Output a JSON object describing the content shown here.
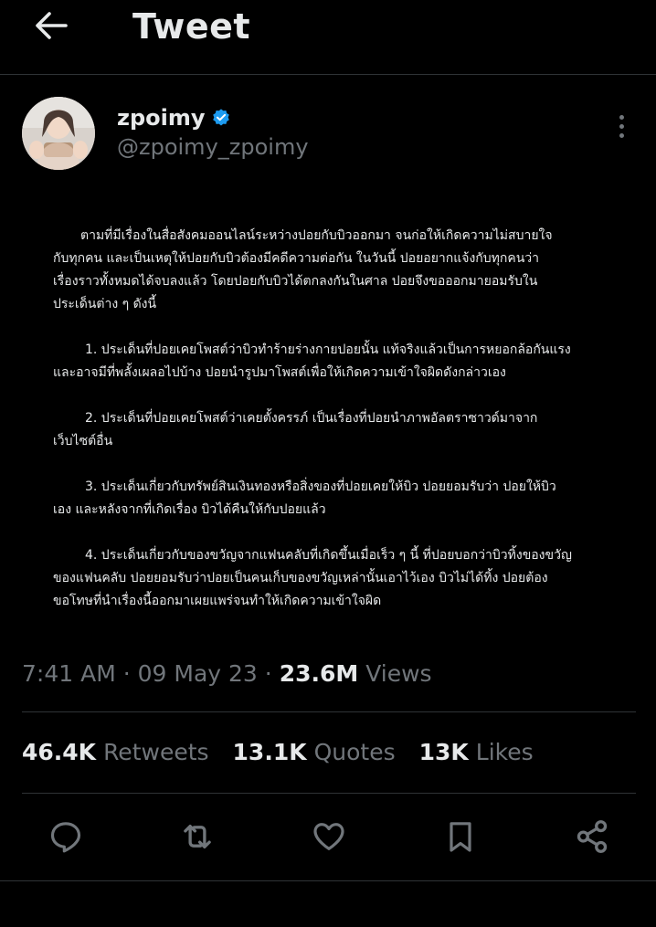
{
  "header": {
    "title": "Tweet",
    "back_icon": "arrow-left-icon"
  },
  "author": {
    "name": "zpoimy",
    "handle": "@zpoimy_zpoimy",
    "verified_color": "#1d9bf0"
  },
  "post": {
    "paragraphs": [
      "ตามที่มีเรื่องในสื่อสังคมออนไลน์ระหว่างปอยกับบิวออกมา จนก่อให้เกิดความไม่สบายใจ\nกับทุกคน และเป็นเหตุให้ปอยกับบิวต้องมีคดีความต่อกัน ในวันนี้ ปอยอยากแจ้งกับทุกคนว่า\nเรื่องราวทั้งหมดได้จบลงแล้ว โดยปอยกับบิวได้ตกลงกันในศาล ปอยจึงขอออกมายอมรับใน\nประเด็นต่าง ๆ ดังนี้",
      "1. ประเด็นที่ปอยเคยโพสต์ว่าบิวทำร้ายร่างกายปอยนั้น แท้จริงแล้วเป็นการหยอกล้อกันแรง\nและอาจมีที่พลั้งเผลอไปบ้าง ปอยนำรูปมาโพสต์เพื่อให้เกิดความเข้าใจผิดดังกล่าวเอง",
      "2. ประเด็นที่ปอยเคยโพสต์ว่าเคยตั้งครรภ์ เป็นเรื่องที่ปอยนำภาพอัลตราซาวด์มาจาก\nเว็บไซต์อื่น",
      "3. ประเด็นเกี่ยวกับทรัพย์สินเงินทองหรือสิ่งของที่ปอยเคยให้บิว ปอยยอมรับว่า ปอยให้บิว\nเอง และหลังจากที่เกิดเรื่อง บิวได้คืนให้กับปอยแล้ว",
      "4. ประเด็นเกี่ยวกับของขวัญจากแฟนคลับที่เกิดขึ้นเมื่อเร็ว ๆ นี้ ที่ปอยบอกว่าบิวทิ้งของขวัญ\nของแฟนคลับ ปอยยอมรับว่าปอยเป็นคนเก็บของขวัญเหล่านั้นเอาไว้เอง บิวไม่ได้ทิ้ง ปอยต้อง\nขอโทษที่นำเรื่องนี้ออกมาเผยแพร่จนทำให้เกิดความเข้าใจผิด"
    ]
  },
  "meta": {
    "time": "7:41 AM",
    "separator": "·",
    "date": "09 May 23",
    "views_count": "23.6M",
    "views_label": "Views"
  },
  "stats": {
    "retweets_count": "46.4K",
    "retweets_label": "Retweets",
    "quotes_count": "13.1K",
    "quotes_label": "Quotes",
    "likes_count": "13K",
    "likes_label": "Likes"
  },
  "actions": {
    "icons": [
      "reply-icon",
      "retweet-icon",
      "like-icon",
      "bookmark-icon",
      "share-icon"
    ]
  }
}
